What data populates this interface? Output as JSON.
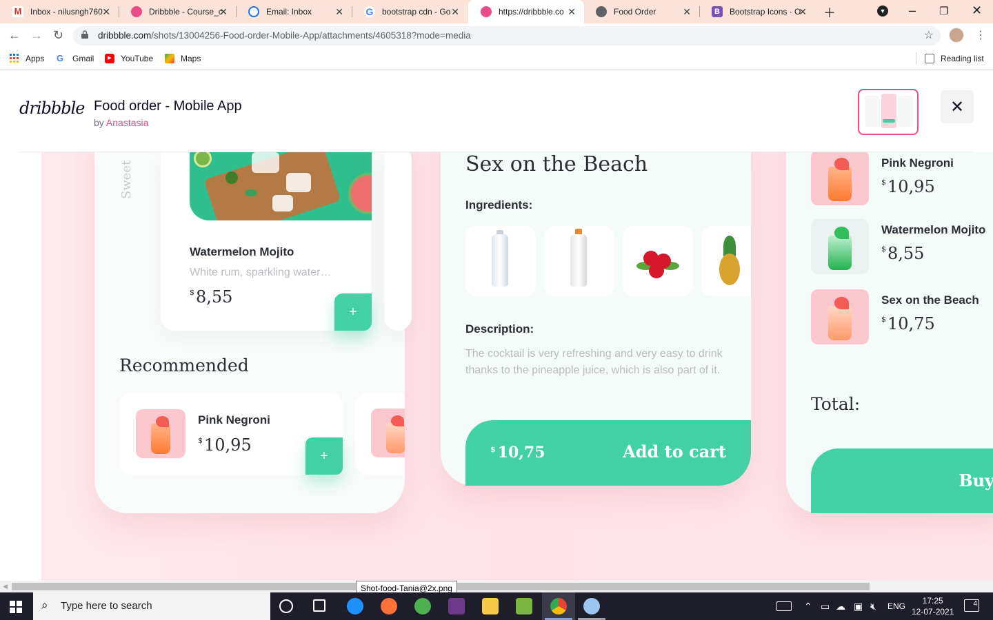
{
  "browser": {
    "tabs": [
      {
        "title": "Inbox - nilusngh760",
        "icon": "gmail-icon"
      },
      {
        "title": "Dribbble - Course_c",
        "icon": "dribbble-icon"
      },
      {
        "title": "Email: Inbox",
        "icon": "email-icon"
      },
      {
        "title": "bootstrap cdn - Go",
        "icon": "google-icon"
      },
      {
        "title": "https://dribbble.co",
        "icon": "dribbble-icon",
        "active": true
      },
      {
        "title": "Food Order",
        "icon": "globe-icon"
      },
      {
        "title": "Bootstrap Icons · O",
        "icon": "bootstrap-icon"
      }
    ],
    "url_host": "dribbble.com",
    "url_path": "/shots/13004256-Food-order-Mobile-App/attachments/4605318?mode=media",
    "bookmarks": [
      {
        "label": "Apps",
        "icon": "apps-grid-icon"
      },
      {
        "label": "Gmail",
        "icon": "google-icon"
      },
      {
        "label": "YouTube",
        "icon": "youtube-icon"
      },
      {
        "label": "Maps",
        "icon": "maps-icon"
      }
    ],
    "reading_list": "Reading list"
  },
  "dribbble": {
    "logo": "dribbble",
    "title": "Food order - Mobile App",
    "by_prefix": "by",
    "author": "Anastasia"
  },
  "shot": {
    "screen1": {
      "side_label": "Sweet",
      "featured": {
        "name": "Watermelon Mojito",
        "subtitle": "White rum, sparkling water…",
        "currency": "$",
        "price": "8,55",
        "add": "+"
      },
      "recommended_title": "Recommended",
      "recommended": {
        "name": "Pink Negroni",
        "currency": "$",
        "price": "10,95",
        "add": "+"
      }
    },
    "screen2": {
      "title": "Sex on the Beach",
      "ingredients_label": "Ingredients:",
      "description_label": "Description:",
      "description": "The cocktail is very refreshing and very easy to drink thanks to the pineapple juice, which is also part of it.",
      "cart_currency": "$",
      "cart_price": "10,75",
      "cart_label": "Add to cart"
    },
    "screen3": {
      "items": [
        {
          "name": "Pink Negroni",
          "currency": "$",
          "price": "10,95"
        },
        {
          "name": "Watermelon Mojito",
          "currency": "$",
          "price": "8,55"
        },
        {
          "name": "Sex on the Beach",
          "currency": "$",
          "price": "10,75"
        }
      ],
      "total_label": "Total:",
      "buy_label": "Buy"
    },
    "colors": {
      "accent": "#41d1a5",
      "brand": "#ea4c89",
      "background": "#fde6ea"
    }
  },
  "scroll_tooltip": "Shot-food-Tania@2x.png",
  "taskbar": {
    "search_placeholder": "Type here to search",
    "language": "ENG",
    "time": "17:25",
    "date": "12-07-2021",
    "notifications": "4"
  }
}
